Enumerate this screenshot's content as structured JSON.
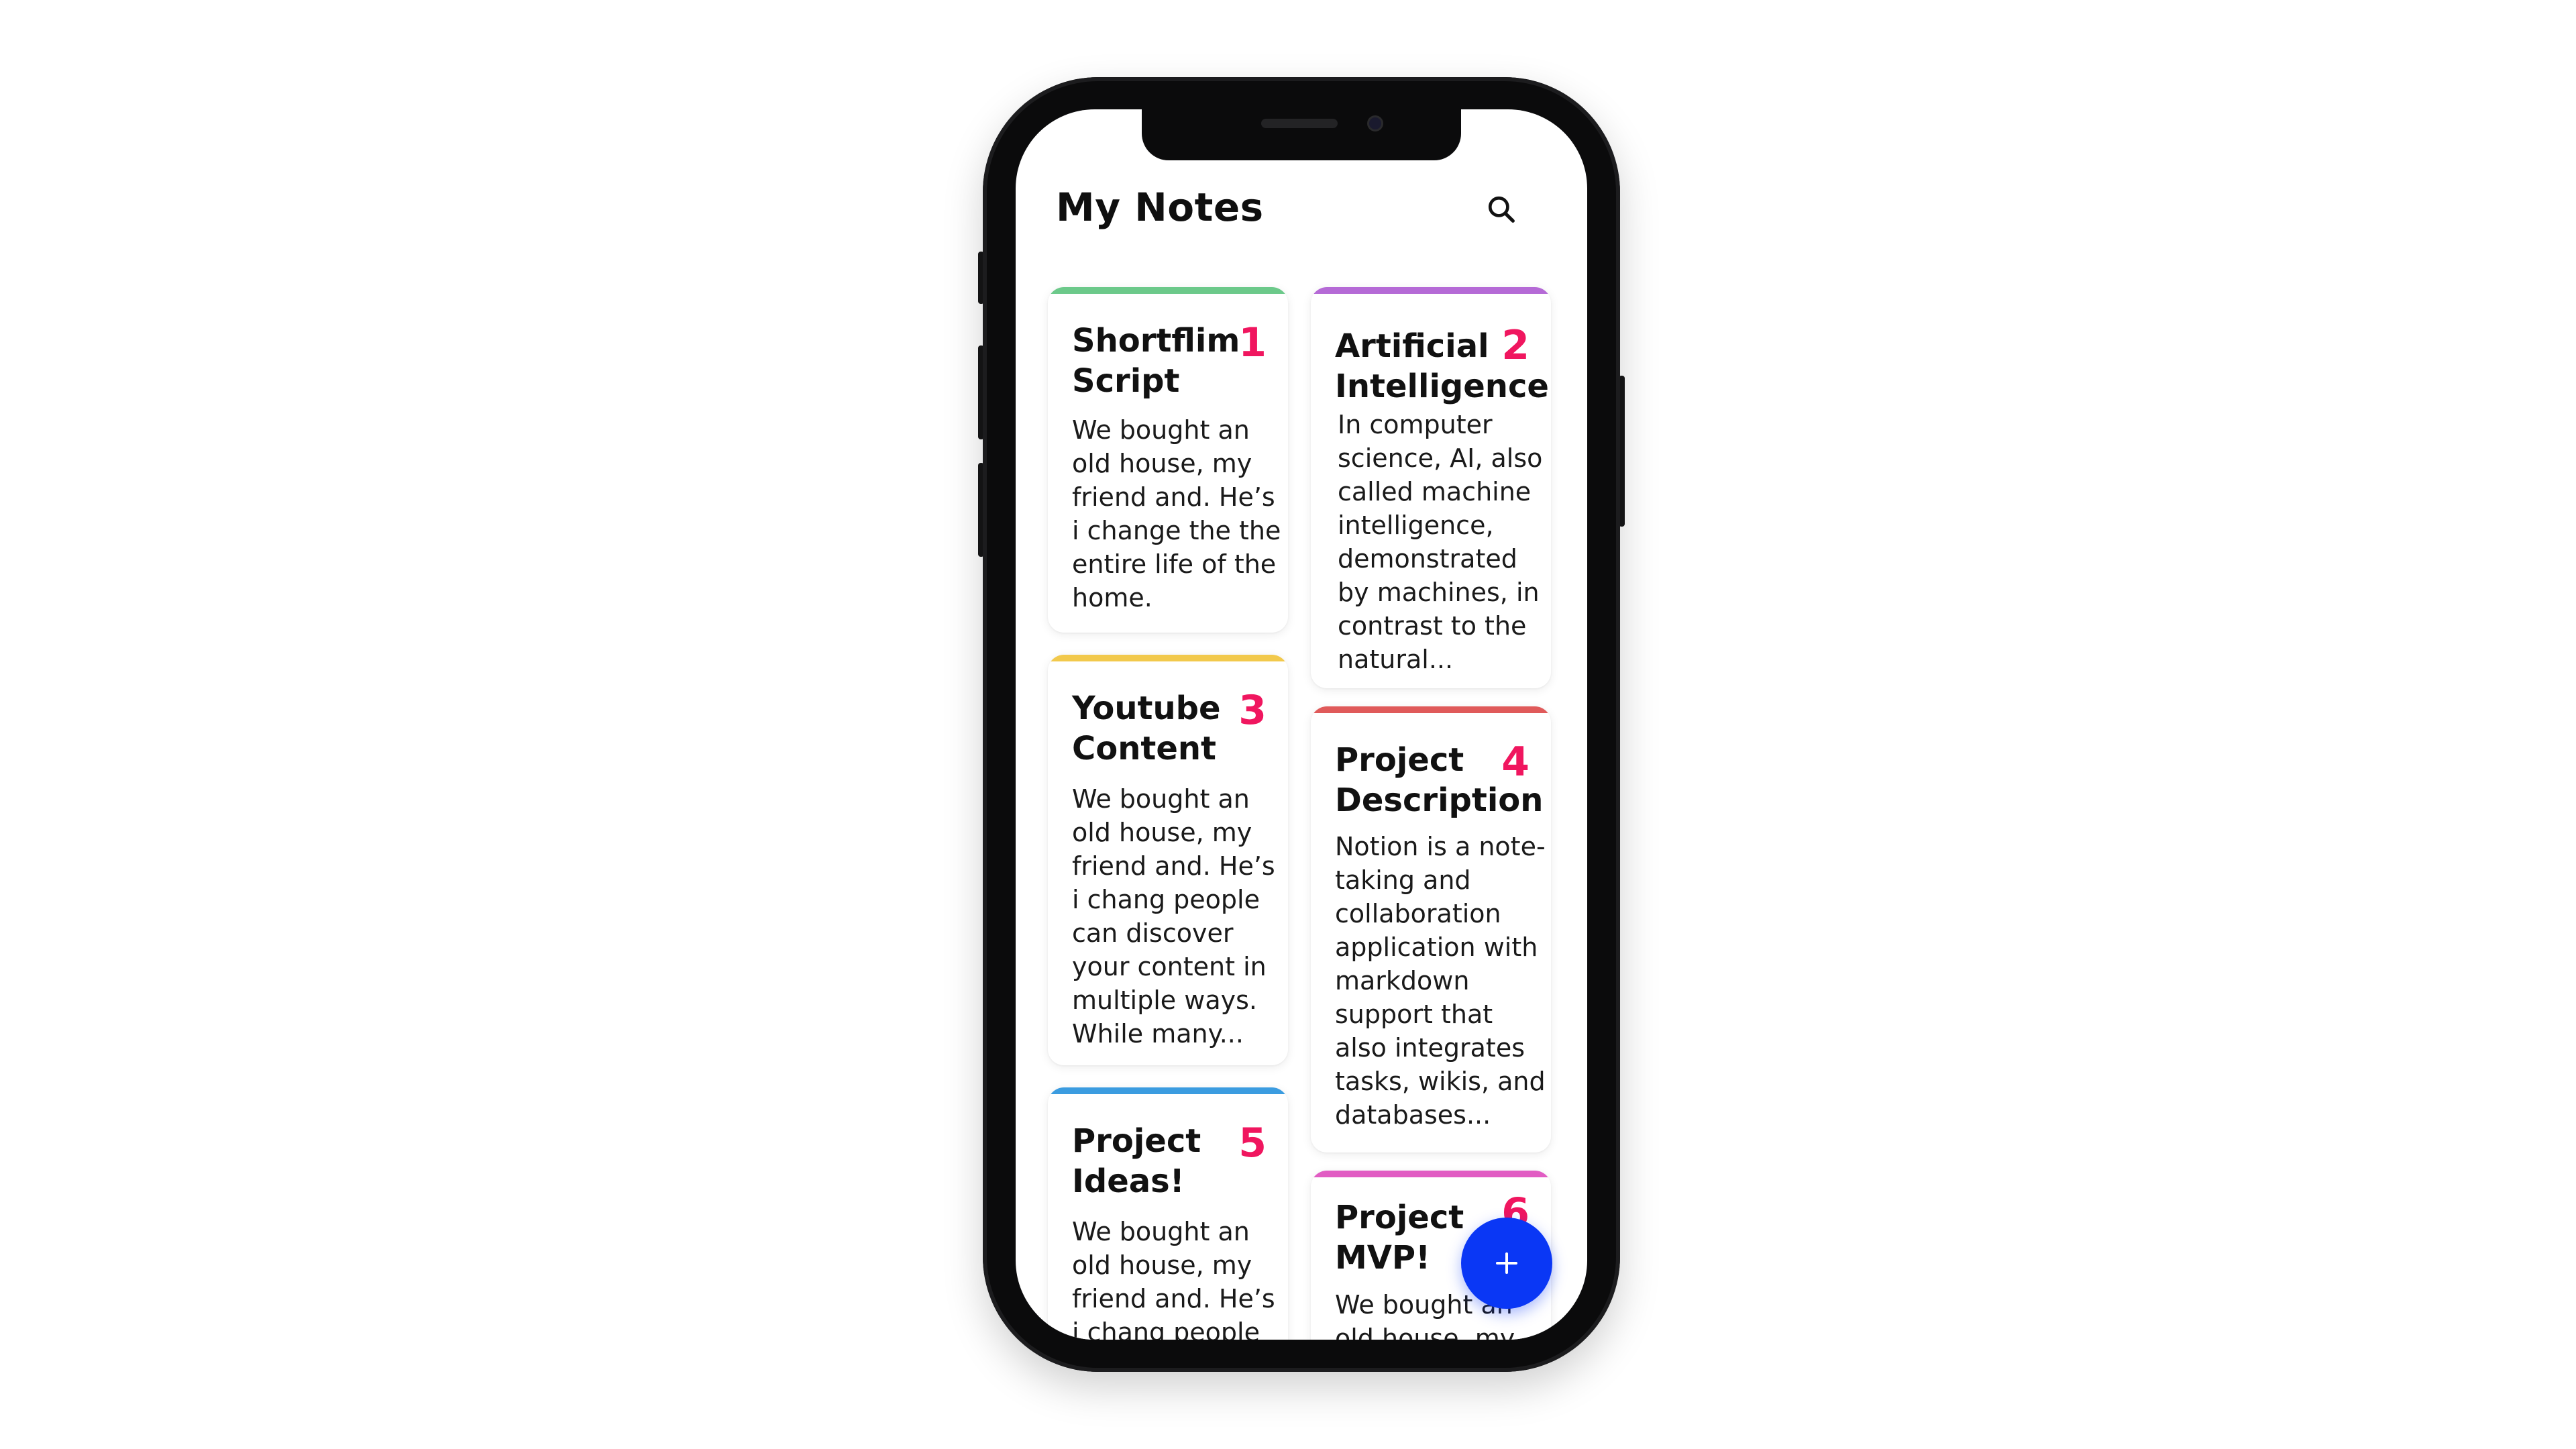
{
  "app": {
    "title": "My Notes"
  },
  "icons": {
    "search": "search-icon",
    "add": "plus-icon"
  },
  "colors": {
    "number_accent": "#f0165f",
    "fab": "#0a37f5"
  },
  "notes": [
    {
      "title": "Shortflim Script",
      "number": "1",
      "body": "We bought an old house, my friend and. He’s i change the the entire life of the home.",
      "color": "#6cc98a"
    },
    {
      "title": "Artificial Intelligence",
      "number": "2",
      "body": "In computer science, AI, also called machine intelligence, demonstrated by machines, in contrast to the natural...",
      "color": "#b56ad6"
    },
    {
      "title": "Youtube Content",
      "number": "3",
      "body": "We bought an old house, my friend and. He’s i chang people can discover your content in multiple ways. While many...",
      "color": "#f2c94c"
    },
    {
      "title": "Project Description",
      "number": "4",
      "body": "Notion is a note-taking and collaboration application with markdown support that also integrates tasks, wikis, and databases...",
      "color": "#e05a5a"
    },
    {
      "title": "Project Ideas!",
      "number": "5",
      "body": "We bought an old house, my friend and. He’s i chang people",
      "color": "#3b9ce0"
    },
    {
      "title": "Project MVP!",
      "number": "6",
      "body": "We bought an old house, my",
      "color": "#e15cc3"
    }
  ]
}
